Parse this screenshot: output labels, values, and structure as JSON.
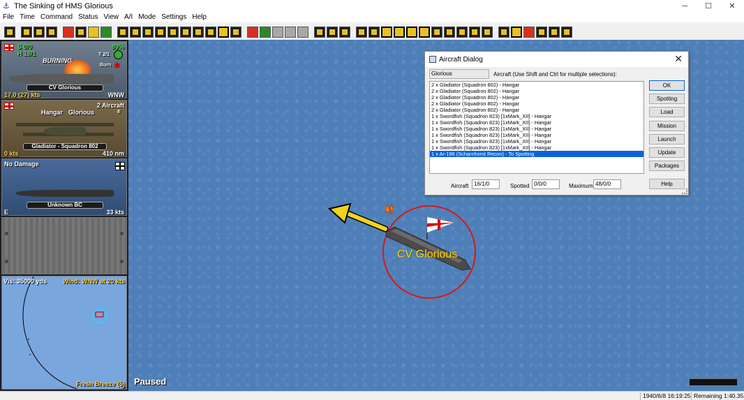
{
  "window": {
    "title": "The Sinking of HMS Glorious",
    "controls": [
      "─",
      "☐",
      "✕"
    ]
  },
  "menu": [
    "File",
    "Time",
    "Command",
    "Status",
    "View",
    "A/I",
    "Mode",
    "Settings",
    "Help"
  ],
  "side_panel": {
    "glorious_card": {
      "top_left": "S 0/0",
      "second_line": "H 18/1",
      "percent": "89%",
      "status": "BURNING",
      "count": "T 2/1",
      "burn": "Burn",
      "plate": "CV Glorious",
      "speed": "17.0 (27) kts",
      "heading": "WNW"
    },
    "aircraft_card": {
      "count": "2 Aircraft",
      "location": "Hangar",
      "ship": "Glorious",
      "small_number": "8",
      "plate": "Gladiator - Squadron 802",
      "speed": "0 kts",
      "range": "410 nm"
    },
    "target_card": {
      "damage": "No Damage",
      "plate": "Unknown BC",
      "heading": "E",
      "speed": "33 kts"
    },
    "radar": {
      "visibility": "Vis: 35000 yds",
      "wind": "Wind: WNW at 20 kts",
      "weather": "Fresh Breeze (5)"
    }
  },
  "map": {
    "paused_label": "Paused",
    "ship_label": "CV Glorious"
  },
  "aircraft_dialog": {
    "title": "Aircraft Dialog",
    "ship_field": "Glorious",
    "instructions": "Aircraft (Use Shift and Ctrl for multiple selections):",
    "list": [
      "2 x Gladiator (Squadron 802) - Hangar",
      "2 x Gladiator (Squadron 802) - Hangar",
      "2 x Gladiator (Squadron 802) - Hangar",
      "2 x Gladiator (Squadron 802) - Hangar",
      "2 x Gladiator (Squadron 802) - Hangar",
      "1 x Swordfish (Squadron 823) [1xMark_XII] - Hangar",
      "1 x Swordfish (Squadron 823) [1xMark_XII] - Hangar",
      "1 x Swordfish (Squadron 823) [1xMark_XII] - Hangar",
      "1 x Swordfish (Squadron 823) [1xMark_XII] - Hangar",
      "1 x Swordfish (Squadron 823) [1xMark_XII] - Hangar",
      "1 x Swordfish (Squadron 823) [1xMark_XII] - Hangar",
      "1 x Ar-196 (Scharnhorst Recon) - To Spotting"
    ],
    "selected_index": 11,
    "buttons": {
      "ok": "OK",
      "spotting": "Spotting",
      "load": "Load",
      "mission": "Mission",
      "launch": "Launch",
      "update": "Update",
      "packages": "Packages",
      "help": "Help"
    },
    "aircraft_label": "Aircraft",
    "aircraft_value": "16/1/0",
    "spotted_label": "Spotted",
    "spotted_value": "0/0/0",
    "maximum_label": "Maximum",
    "maximum_value": "48/0/0"
  },
  "status_bar": {
    "datetime": "1940/6/8 16:19:25",
    "remaining": "Remaining 1:40.35"
  }
}
